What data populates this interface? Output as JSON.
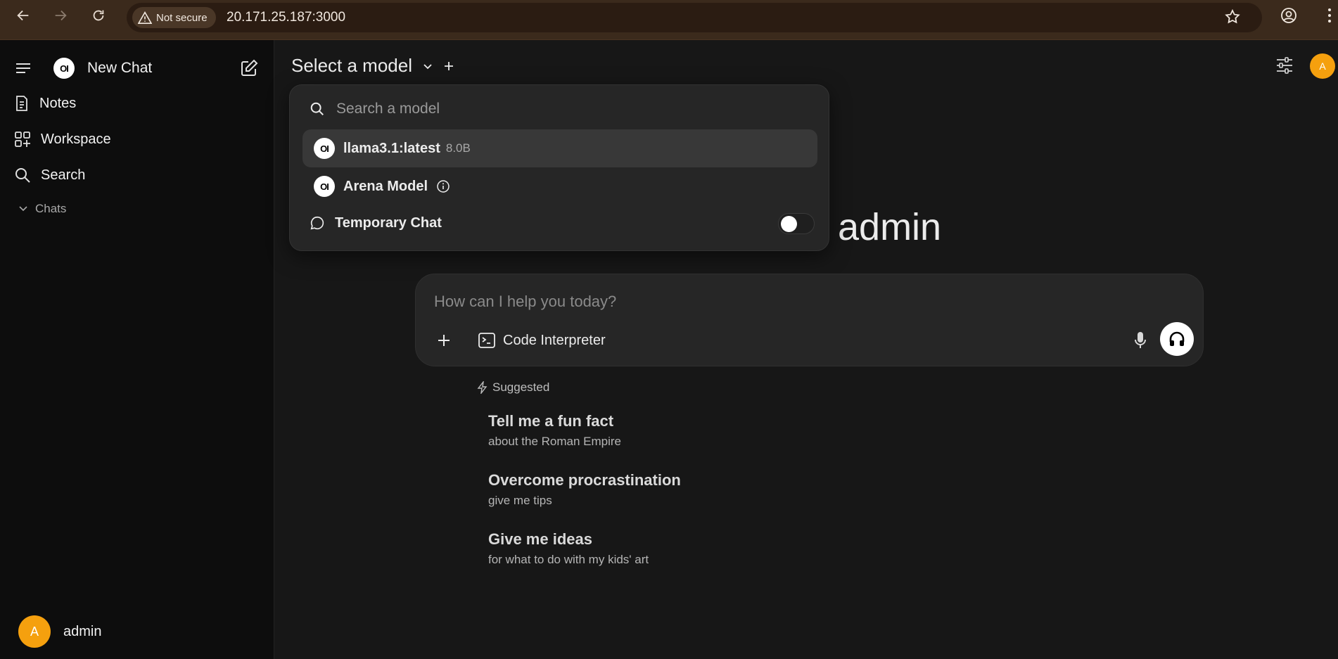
{
  "browser": {
    "security_label": "Not secure",
    "url": "20.171.25.187:3000"
  },
  "sidebar": {
    "new_chat_label": "New Chat",
    "logo_text": "OI",
    "items": [
      {
        "label": "Notes"
      },
      {
        "label": "Workspace"
      },
      {
        "label": "Search"
      }
    ],
    "chats_label": "Chats",
    "user": {
      "initial": "A",
      "name": "admin"
    }
  },
  "header": {
    "model_select_label": "Select a model",
    "avatar_initial": "A"
  },
  "greeting": {
    "name": "admin"
  },
  "model_dropdown": {
    "search_placeholder": "Search a model",
    "models": [
      {
        "name": "llama3.1:latest",
        "size": "8.0B",
        "logo": "OI"
      },
      {
        "name": "Arena Model",
        "logo": "OI"
      }
    ],
    "temporary_chat_label": "Temporary Chat",
    "temporary_chat_enabled": false
  },
  "chat_input": {
    "placeholder": "How can I help you today?",
    "code_interpreter_label": "Code Interpreter"
  },
  "suggestions": {
    "heading": "Suggested",
    "items": [
      {
        "title": "Tell me a fun fact",
        "subtitle": "about the Roman Empire"
      },
      {
        "title": "Overcome procrastination",
        "subtitle": "give me tips"
      },
      {
        "title": "Give me ideas",
        "subtitle": "for what to do with my kids' art"
      }
    ]
  },
  "colors": {
    "avatar": "#f5a00e",
    "background": "#171717",
    "sidebar": "#0d0d0d",
    "dropdown": "#262626"
  }
}
